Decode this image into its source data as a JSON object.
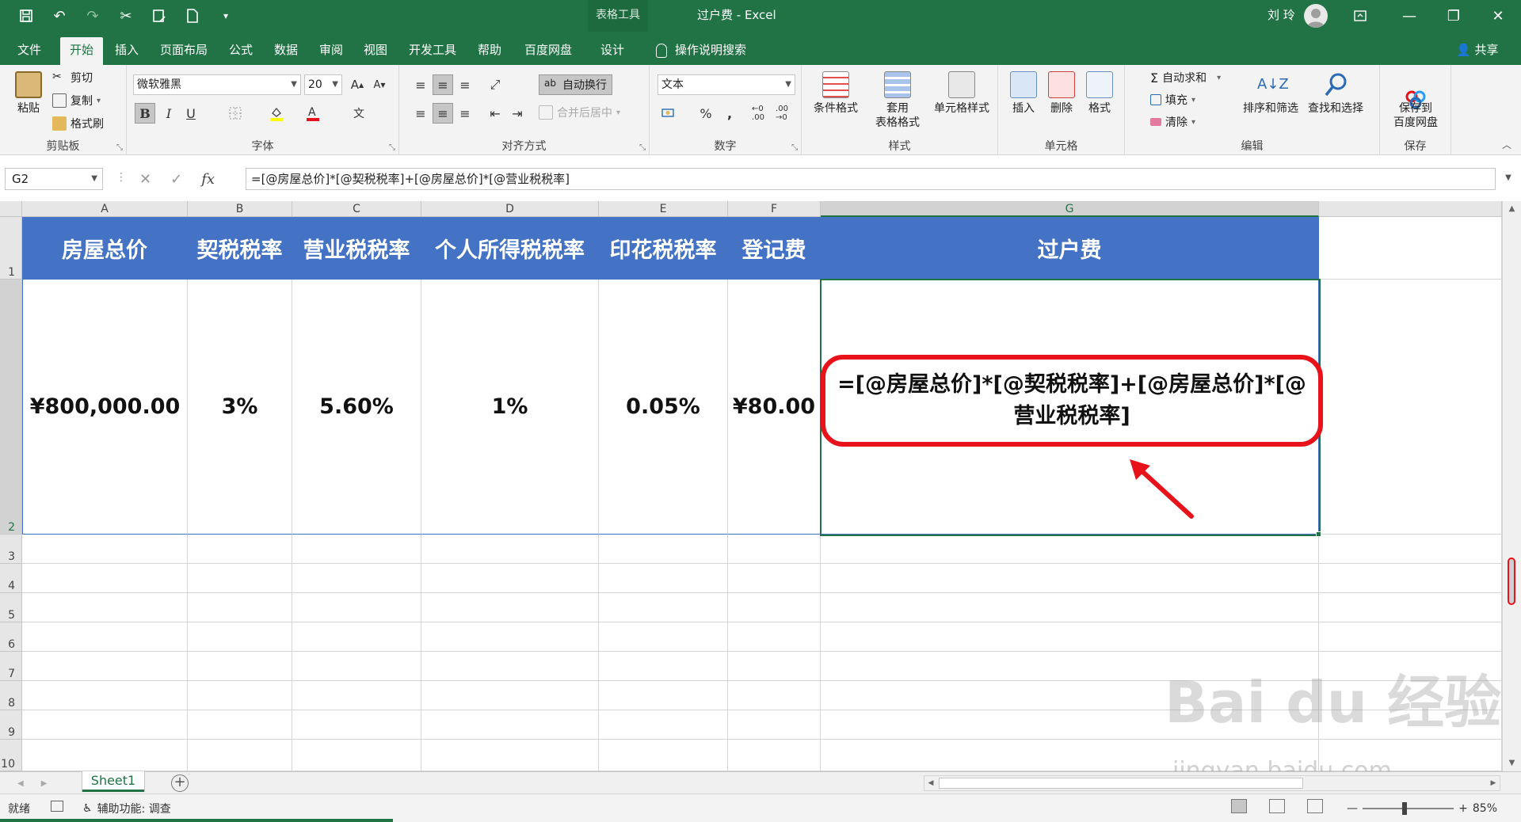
{
  "title_bar": {
    "context_tab_label": "表格工具",
    "window_title": "过户费  -  Excel",
    "user_name": "刘 玲",
    "qat_icons": [
      "save-icon",
      "undo-icon",
      "redo-icon",
      "cut-icon",
      "save-as-icon",
      "new-doc-icon",
      "customize-icon"
    ]
  },
  "tabs": [
    {
      "label": "文件"
    },
    {
      "label": "开始"
    },
    {
      "label": "插入"
    },
    {
      "label": "页面布局"
    },
    {
      "label": "公式"
    },
    {
      "label": "数据"
    },
    {
      "label": "审阅"
    },
    {
      "label": "视图"
    },
    {
      "label": "开发工具"
    },
    {
      "label": "帮助"
    },
    {
      "label": "百度网盘"
    },
    {
      "label": "设计"
    }
  ],
  "active_tab": "开始",
  "tell_me": "操作说明搜索",
  "share": "共享",
  "ribbon": {
    "clipboard": {
      "paste": "粘贴",
      "cut": "剪切",
      "copy": "复制",
      "format_painter": "格式刷",
      "label": "剪贴板"
    },
    "font": {
      "name": "微软雅黑",
      "size": "20",
      "bold": "B",
      "italic": "I",
      "underline": "U",
      "label": "字体"
    },
    "alignment": {
      "wrap_text": "自动换行",
      "merge_center": "合并后居中",
      "label": "对齐方式"
    },
    "number": {
      "format": "文本",
      "percent": "%",
      "comma": ",",
      "label": "数字"
    },
    "styles": {
      "conditional": "条件格式",
      "table_format": "套用\n表格格式",
      "cell_styles": "单元格样式",
      "label": "样式"
    },
    "cells": {
      "insert": "插入",
      "delete": "删除",
      "format": "格式",
      "label": "单元格"
    },
    "editing": {
      "autosum": "自动求和",
      "fill": "填充",
      "clear": "清除",
      "sort_filter": "排序和筛选",
      "find_select": "查找和选择",
      "label": "编辑"
    },
    "save": {
      "save_to": "保存到\n百度网盘",
      "label": "保存"
    }
  },
  "formula_bar": {
    "name_box": "G2",
    "formula": "=[@房屋总价]*[@契税税率]+[@房屋总价]*[@营业税税率]",
    "fx": "fx"
  },
  "grid": {
    "columns": [
      "A",
      "B",
      "C",
      "D",
      "E",
      "F",
      "G"
    ],
    "rows": [
      "1",
      "2",
      "3",
      "4",
      "5",
      "6",
      "7",
      "8",
      "9",
      "10"
    ],
    "header_row": [
      "房屋总价",
      "契税税率",
      "营业税税率",
      "个人所得税税率",
      "印花税税率",
      "登记费",
      "过户费"
    ],
    "data_row": [
      "¥800,000.00",
      "3%",
      "5.60%",
      "1%",
      "0.05%",
      "¥80.00",
      ""
    ],
    "selected_cell": "G2",
    "callout_text": "=[@房屋总价]*[@契税税率]+[@房屋总价]*[@营业税税率]"
  },
  "sheets": [
    {
      "name": "Sheet1"
    }
  ],
  "status_bar": {
    "ready": "就绪",
    "accessibility": "辅助功能: 调查",
    "zoom": "85%",
    "zoom_level": 0.85
  },
  "watermark": {
    "brand": "Bai du 经验",
    "url": "jingyan.baidu.com"
  },
  "colors": {
    "excel_green": "#217346",
    "table_header": "#4472c4",
    "callout_red": "#e8131a"
  }
}
